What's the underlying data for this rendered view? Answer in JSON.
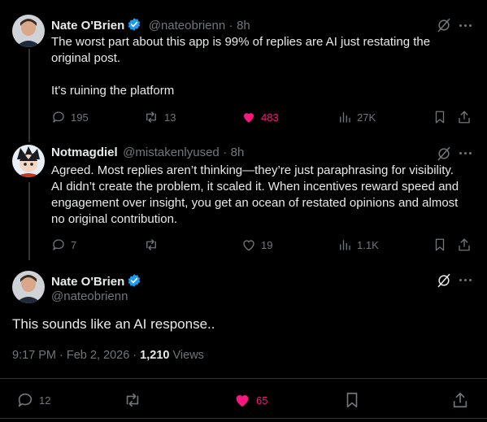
{
  "tweet1": {
    "name": "Nate O'Brien",
    "handle": "@nateobrienn",
    "sep": "·",
    "time": "8h",
    "text_line1": "The worst part about this app is 99% of replies are AI just restating the",
    "text_line2": "original post.",
    "text_line3": "It's ruining the platform",
    "replies": "195",
    "retweets": "13",
    "likes": "483",
    "views": "27K"
  },
  "tweet2": {
    "name": "Notmagdiel",
    "handle": "@mistakenlyused",
    "sep": "·",
    "time": "8h",
    "lines": [
      "Agreed. Most replies aren’t thinking—they’re just paraphrasing for visibility.",
      "AI didn’t create the problem, it scaled it. When incentives reward speed and",
      "engagement over insight, you get an ocean of restated opinions and almost",
      "no original contribution."
    ],
    "replies": "7",
    "likes": "19",
    "views": "1.1K"
  },
  "tweet3": {
    "name": "Nate O'Brien",
    "handle": "@nateobrienn",
    "text": "This sounds like an AI response..",
    "timestamp": "9:17 PM · Feb 2, 2026 · ",
    "views_count": "1,210",
    "views_label": " Views",
    "replies": "12",
    "likes": "65"
  },
  "colors": {
    "like_pink": "#f91880",
    "verified_blue": "#1d9bf0",
    "muted": "#71767b"
  },
  "icons": [
    "verified-badge-icon",
    "grok-icon",
    "more-icon",
    "reply-icon",
    "retweet-icon",
    "like-icon",
    "views-icon",
    "bookmark-icon",
    "share-icon"
  ]
}
